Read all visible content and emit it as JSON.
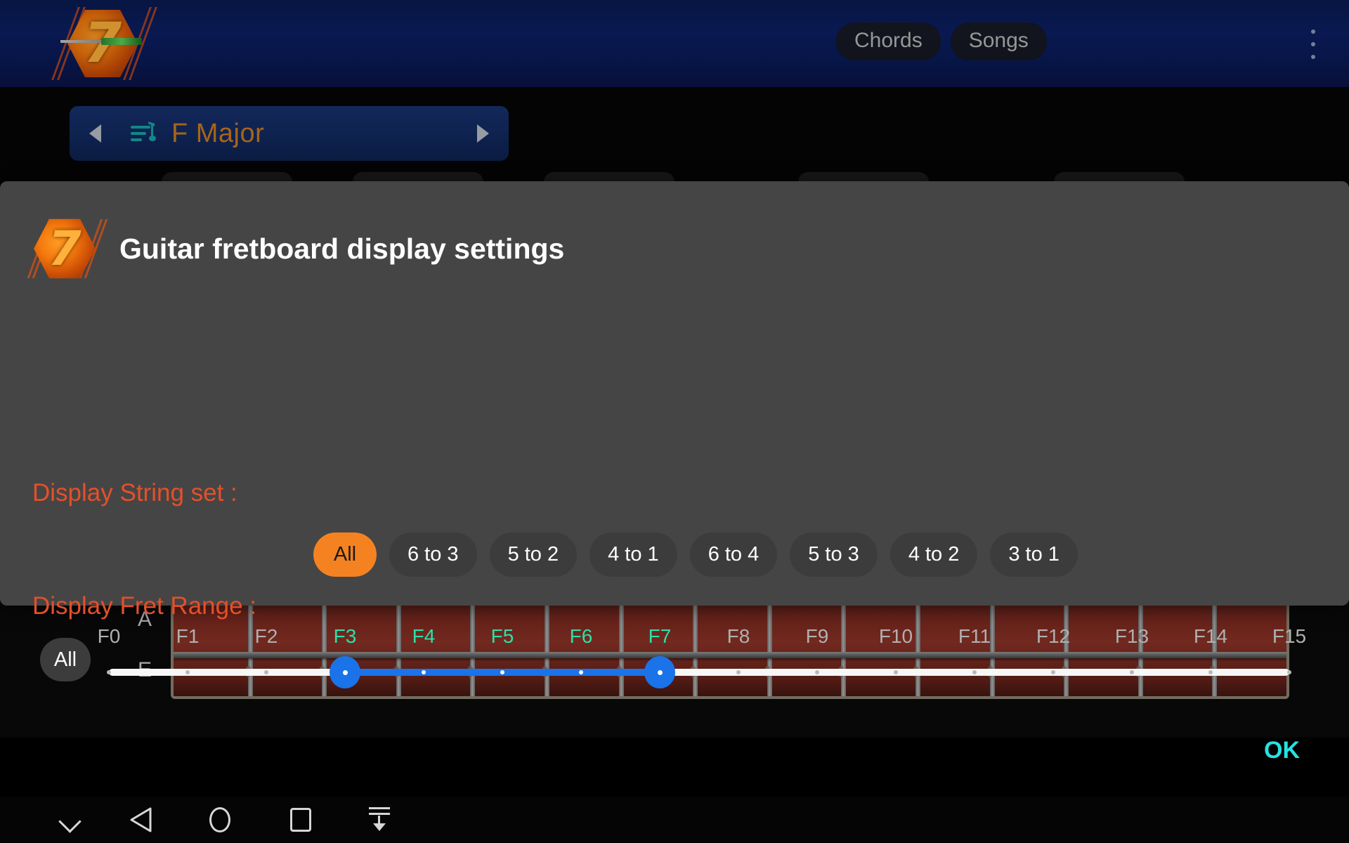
{
  "app": {
    "logo_icon": "seven-hex-guitar-logo",
    "tabs": [
      {
        "label": "Chords",
        "name": "tab-chords"
      },
      {
        "label": "Songs",
        "name": "tab-songs"
      }
    ],
    "overflow_icon": "more-vertical-icon"
  },
  "chord_selector": {
    "prev_icon": "triangle-left-icon",
    "next_icon": "triangle-right-icon",
    "list_icon": "music-note-list-icon",
    "value": "F Major",
    "value_color": "#cc7a22"
  },
  "dialog": {
    "logo_icon": "seven-hex-logo",
    "title": "Guitar fretboard display settings",
    "string_set": {
      "label": "Display String set :",
      "label_color": "#e4502a",
      "selected": "All",
      "options": [
        "All",
        "6 to 3",
        "5 to 2",
        "4 to 1",
        "6 to 4",
        "5 to 3",
        "4 to 2",
        "3 to 1"
      ]
    },
    "fret_range": {
      "label": "Display Fret Range :",
      "label_color": "#e4502a",
      "all_button": "All",
      "ticks": [
        "F0",
        "F1",
        "F2",
        "F3",
        "F4",
        "F5",
        "F6",
        "F7",
        "F8",
        "F9",
        "F10",
        "F11",
        "F12",
        "F13",
        "F14",
        "F15"
      ],
      "active_ticks": [
        "F3",
        "F4",
        "F5",
        "F6",
        "F7"
      ],
      "range_start": "F3",
      "range_end": "F7",
      "track_color": "#f7f7f7",
      "active_color": "#1a73e8",
      "active_label_color": "#2ce0a8"
    },
    "ok_label": "OK",
    "ok_color": "#25e3df",
    "background_color": "#454545"
  },
  "fretboard": {
    "string_labels": [
      "A",
      "E"
    ],
    "wood_color": "#7c2a20"
  },
  "navbar": {
    "buttons": [
      {
        "name": "nav-hide-keyboard",
        "icon": "chevron-down-icon"
      },
      {
        "name": "nav-back",
        "icon": "triangle-back-icon"
      },
      {
        "name": "nav-home",
        "icon": "circle-home-icon"
      },
      {
        "name": "nav-recents",
        "icon": "square-recents-icon"
      },
      {
        "name": "nav-collapse",
        "icon": "arrow-down-lines-icon"
      }
    ]
  }
}
